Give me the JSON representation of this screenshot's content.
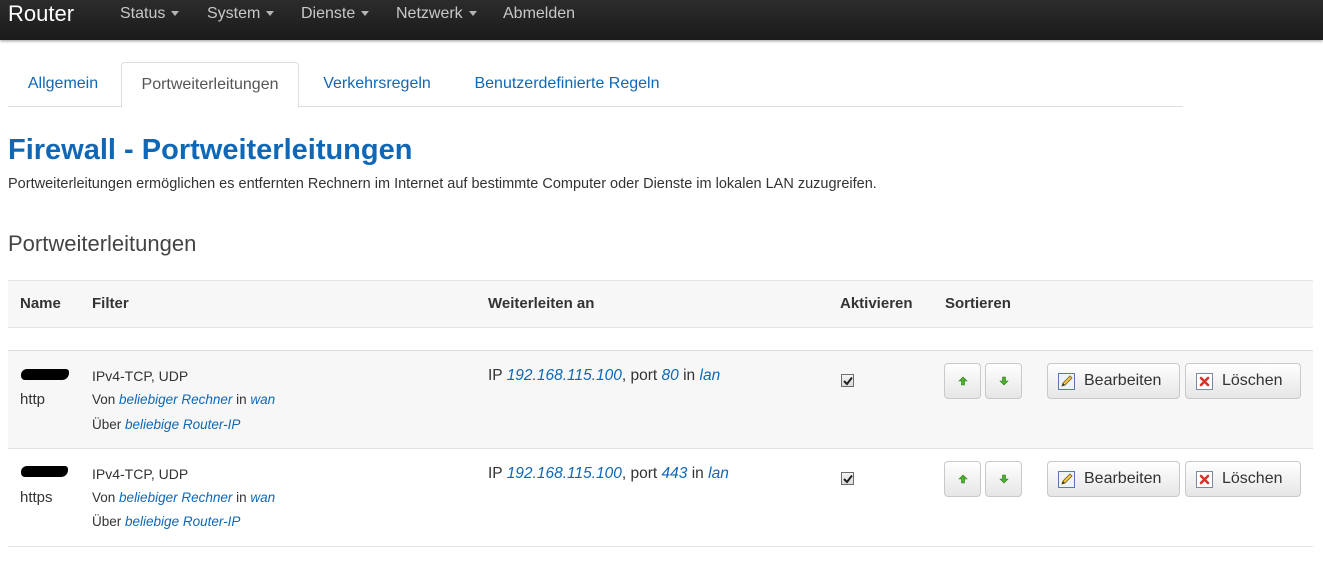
{
  "navbar": {
    "brand": "Router",
    "items": [
      {
        "label": "Status",
        "dropdown": true
      },
      {
        "label": "System",
        "dropdown": true
      },
      {
        "label": "Dienste",
        "dropdown": true
      },
      {
        "label": "Netzwerk",
        "dropdown": true
      },
      {
        "label": "Abmelden",
        "dropdown": false
      }
    ]
  },
  "tabs": [
    {
      "label": "Allgemein",
      "active": false
    },
    {
      "label": "Portweiterleitungen",
      "active": true
    },
    {
      "label": "Verkehrsregeln",
      "active": false
    },
    {
      "label": "Benutzerdefinierte Regeln",
      "active": false
    }
  ],
  "page": {
    "title": "Firewall - Portweiterleitungen",
    "description": "Portweiterleitungen ermöglichen es entfernten Rechnern im Internet auf bestimmte Computer oder Dienste im lokalen LAN zuzugreifen.",
    "section_title": "Portweiterleitungen"
  },
  "table": {
    "headers": {
      "name": "Name",
      "filter": "Filter",
      "forward": "Weiterleiten an",
      "enable": "Aktivieren",
      "sort": "Sortieren"
    },
    "rows": [
      {
        "name": "http",
        "filter_proto": "IPv4-TCP, UDP",
        "from_prefix": "Von",
        "from_host": "beliebiger Rechner",
        "from_in": "in",
        "from_zone": "wan",
        "via_prefix": "Über",
        "via_ip": "beliebige Router-IP",
        "fwd_prefix": "IP",
        "fwd_ip": "192.168.115.100",
        "fwd_port_prefix": ", port",
        "fwd_port": "80",
        "fwd_in": "in",
        "fwd_zone": "lan",
        "enabled": true
      },
      {
        "name": "https",
        "filter_proto": "IPv4-TCP, UDP",
        "from_prefix": "Von",
        "from_host": "beliebiger Rechner",
        "from_in": "in",
        "from_zone": "wan",
        "via_prefix": "Über",
        "via_ip": "beliebige Router-IP",
        "fwd_prefix": "IP",
        "fwd_ip": "192.168.115.100",
        "fwd_port_prefix": ", port",
        "fwd_port": "443",
        "fwd_in": "in",
        "fwd_zone": "lan",
        "enabled": true
      }
    ],
    "buttons": {
      "edit": "Bearbeiten",
      "delete": "Löschen"
    }
  },
  "colors": {
    "link": "#0f68b7",
    "navbar": "#1f1f1f",
    "arrow_icon": "#4caf2e",
    "delete_icon": "#d9342b"
  },
  "icons": {
    "up": "arrow-up-icon",
    "down": "arrow-down-icon",
    "edit": "edit-icon",
    "delete": "delete-icon",
    "check": "check-icon"
  }
}
